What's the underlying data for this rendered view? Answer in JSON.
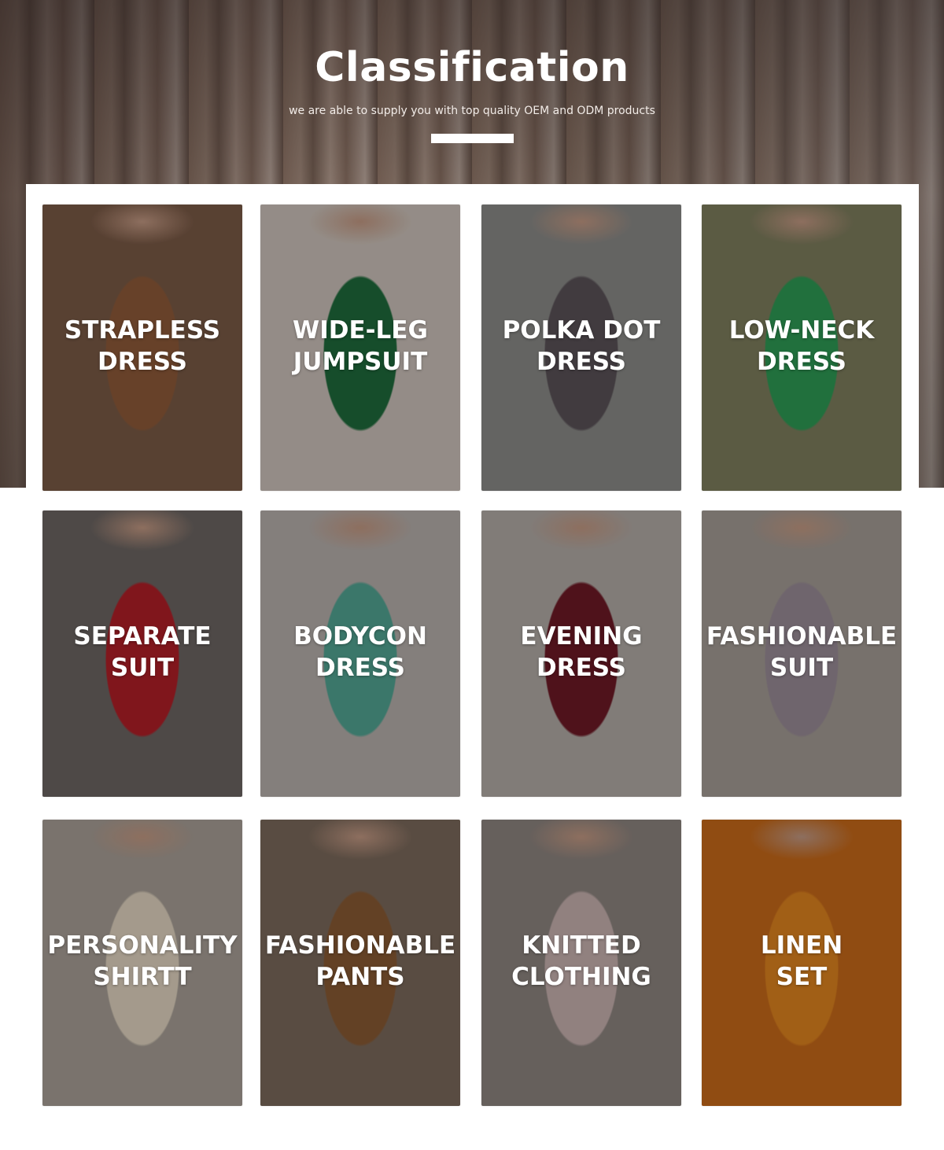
{
  "header": {
    "title": "Classification",
    "subtitle": "we are able to supply you with top quality OEM and ODM products"
  },
  "categories": [
    {
      "label": "STRAPLESS\nDRESS",
      "bg": "#7a5a46",
      "garment": "#8f5b3a"
    },
    {
      "label": "WIDE-LEG\nJUMPSUIT",
      "bg": "#cdc3bb",
      "garment": "#1f6b3c"
    },
    {
      "label": "POLKA DOT\nDRESS",
      "bg": "#8b8b88",
      "garment": "#5a5258"
    },
    {
      "label": "LOW-NECK\nDRESS",
      "bg": "#7f7e5e",
      "garment": "#2f9b55"
    },
    {
      "label": "SEPARATE\nSUIT",
      "bg": "#6d6663",
      "garment": "#b21f28"
    },
    {
      "label": "BODYCON\nDRESS",
      "bg": "#b8b0ac",
      "garment": "#52a594"
    },
    {
      "label": "EVENING\nDRESS",
      "bg": "#b3aca7",
      "garment": "#6e1a26"
    },
    {
      "label": "FASHIONABLE\nSUIT",
      "bg": "#a59d96",
      "garment": "#9a8c97"
    },
    {
      "label": "PERSONALITY\nSHIRTT",
      "bg": "#a9a097",
      "garment": "#e3d6c2"
    },
    {
      "label": "FASHIONABLE\nPANTS",
      "bg": "#7c6a5c",
      "garment": "#8a5b34"
    },
    {
      "label": "KNITTED\nCLOTHING",
      "bg": "#8e8580",
      "garment": "#c9b3b1"
    },
    {
      "label": "LINEN\nSET",
      "bg": "#c86a1a",
      "garment": "#e0841f"
    }
  ]
}
